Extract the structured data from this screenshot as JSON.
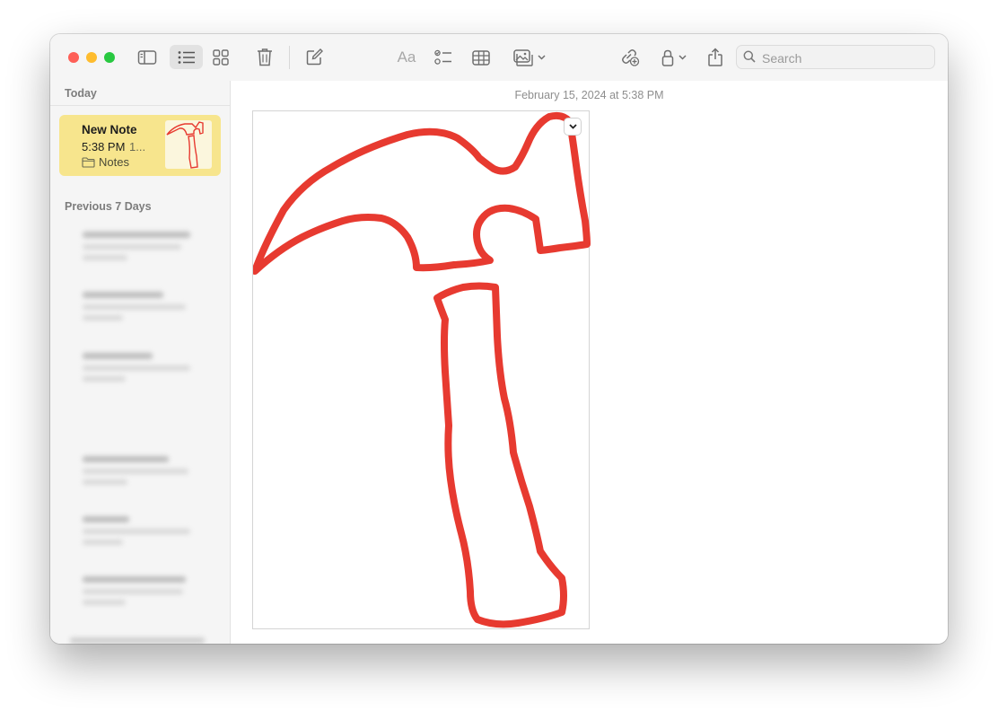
{
  "app": {
    "accent_color": "#f7e58d",
    "drawing_color": "#e73a30"
  },
  "toolbar": {
    "icons": [
      "sidebar-toggle-icon",
      "list-view-icon",
      "gallery-view-icon",
      "trash-icon",
      "compose-icon",
      "text-format-icon",
      "checklist-icon",
      "table-icon",
      "media-icon",
      "collaborate-icon",
      "lock-icon",
      "share-icon"
    ],
    "format_label": "Aa",
    "search_placeholder": "Search"
  },
  "sidebar": {
    "sections": {
      "today": "Today",
      "previous_7_days": "Previous 7 Days"
    },
    "selected_note": {
      "title": "New Note",
      "time": "5:38 PM",
      "snippet": "1...",
      "folder": "Notes"
    }
  },
  "editor": {
    "date": "February 15, 2024 at 5:38 PM"
  }
}
